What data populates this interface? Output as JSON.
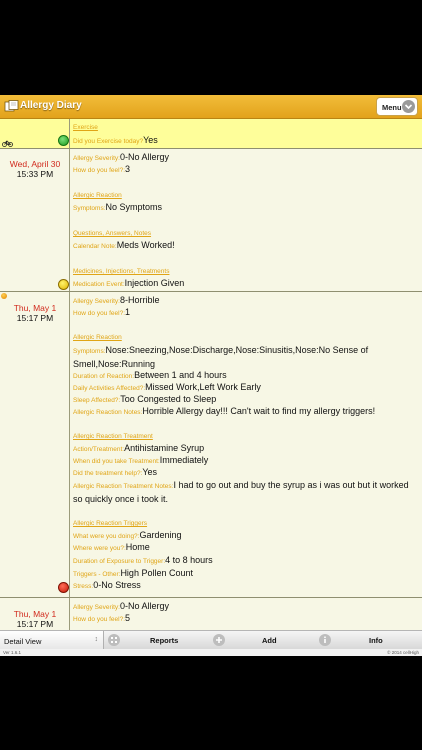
{
  "app": {
    "title": "Allergy Diary",
    "menu_label": "Menu"
  },
  "entries": [
    {
      "id": "exercise",
      "lines": [
        {
          "kind": "section",
          "text": "Exercise"
        },
        {
          "label": "Did you Exercise today?",
          "value": "Yes"
        }
      ],
      "mood": "green"
    },
    {
      "day": "Wed, April 30",
      "time": "15:33 PM",
      "lines": [
        {
          "label": "Allergy Severity:",
          "value": "0-No Allergy"
        },
        {
          "label": "How do you feel?:",
          "value": "3"
        },
        {
          "kind": "section",
          "text": "Allergic Reaction"
        },
        {
          "label": "Symptoms:",
          "value": "No Symptoms"
        },
        {
          "kind": "section",
          "text": "Questions, Answers, Notes"
        },
        {
          "label": "Calendar Note:",
          "value": "Meds Worked!"
        },
        {
          "kind": "section",
          "text": "Medicines, Injections, Treatments"
        },
        {
          "label": "Medication Event:",
          "value": "Injection Given"
        }
      ],
      "mood": "yellow"
    },
    {
      "day": "Thu, May 1",
      "time": "15:17 PM",
      "lines": [
        {
          "label": "Allergy Severity:",
          "value": "8-Horrible"
        },
        {
          "label": "How do you feel?:",
          "value": "1"
        },
        {
          "kind": "section",
          "text": "Allergic Reaction"
        },
        {
          "label": "Symptoms:",
          "value": "Nose:Sneezing,Nose:Discharge,Nose:Sinusitis,Nose:No Sense of Smell,Nose:Running"
        },
        {
          "label": "Duration of Reaction:",
          "value": "Between 1 and 4 hours"
        },
        {
          "label": "Daily Activities Affected?:",
          "value": "Missed Work,Left Work Early"
        },
        {
          "label": "Sleep Affected?:",
          "value": "Too Congested to Sleep"
        },
        {
          "label": "Allergic Reaction Notes:",
          "value": "Horrible Allergy day!!! Can't wait to find my allergy triggers!"
        },
        {
          "kind": "section",
          "text": "Allergic Reaction Treatment"
        },
        {
          "label": "Action/Treatment:",
          "value": "Antihistamine Syrup"
        },
        {
          "label": "When did you take Treatment:",
          "value": "Immediately"
        },
        {
          "label": "Did the treatment help?:",
          "value": "Yes"
        },
        {
          "label": "Allergic Reaction Treatment Notes:",
          "value": "I had to go out and buy the syrup as i was out but it worked so quickly once i took it."
        },
        {
          "kind": "section",
          "text": "Allergic Reaction Triggers"
        },
        {
          "label": "What were you doing?:",
          "value": "Gardening"
        },
        {
          "label": "Where were you?:",
          "value": "Home"
        },
        {
          "label": "Duration of Exposure to Trigger:",
          "value": "4 to 8 hours"
        },
        {
          "label": "Triggers - Other:",
          "value": "High Pollen Count"
        },
        {
          "label": "Stress:",
          "value": "0-No Stress"
        }
      ],
      "mood": "red"
    },
    {
      "day": "Thu, May 1",
      "time": "15:17 PM",
      "lines": [
        {
          "label": "Allergy Severity:",
          "value": "0-No Allergy"
        },
        {
          "label": "How do you feel?:",
          "value": "5"
        }
      ]
    }
  ],
  "toolbar": {
    "view_select": "Detail View",
    "reports": "Reports",
    "add": "Add",
    "info": "Info"
  },
  "footer": {
    "version": "Ver 1.6.1",
    "copyright": "© 2014 cellHigh"
  },
  "colors": {
    "header": "#e8ab22",
    "label": "#e0a516",
    "date": "#d12a1d",
    "row_highlight": "#fefe9a",
    "row_normal": "#f7f7e5"
  }
}
